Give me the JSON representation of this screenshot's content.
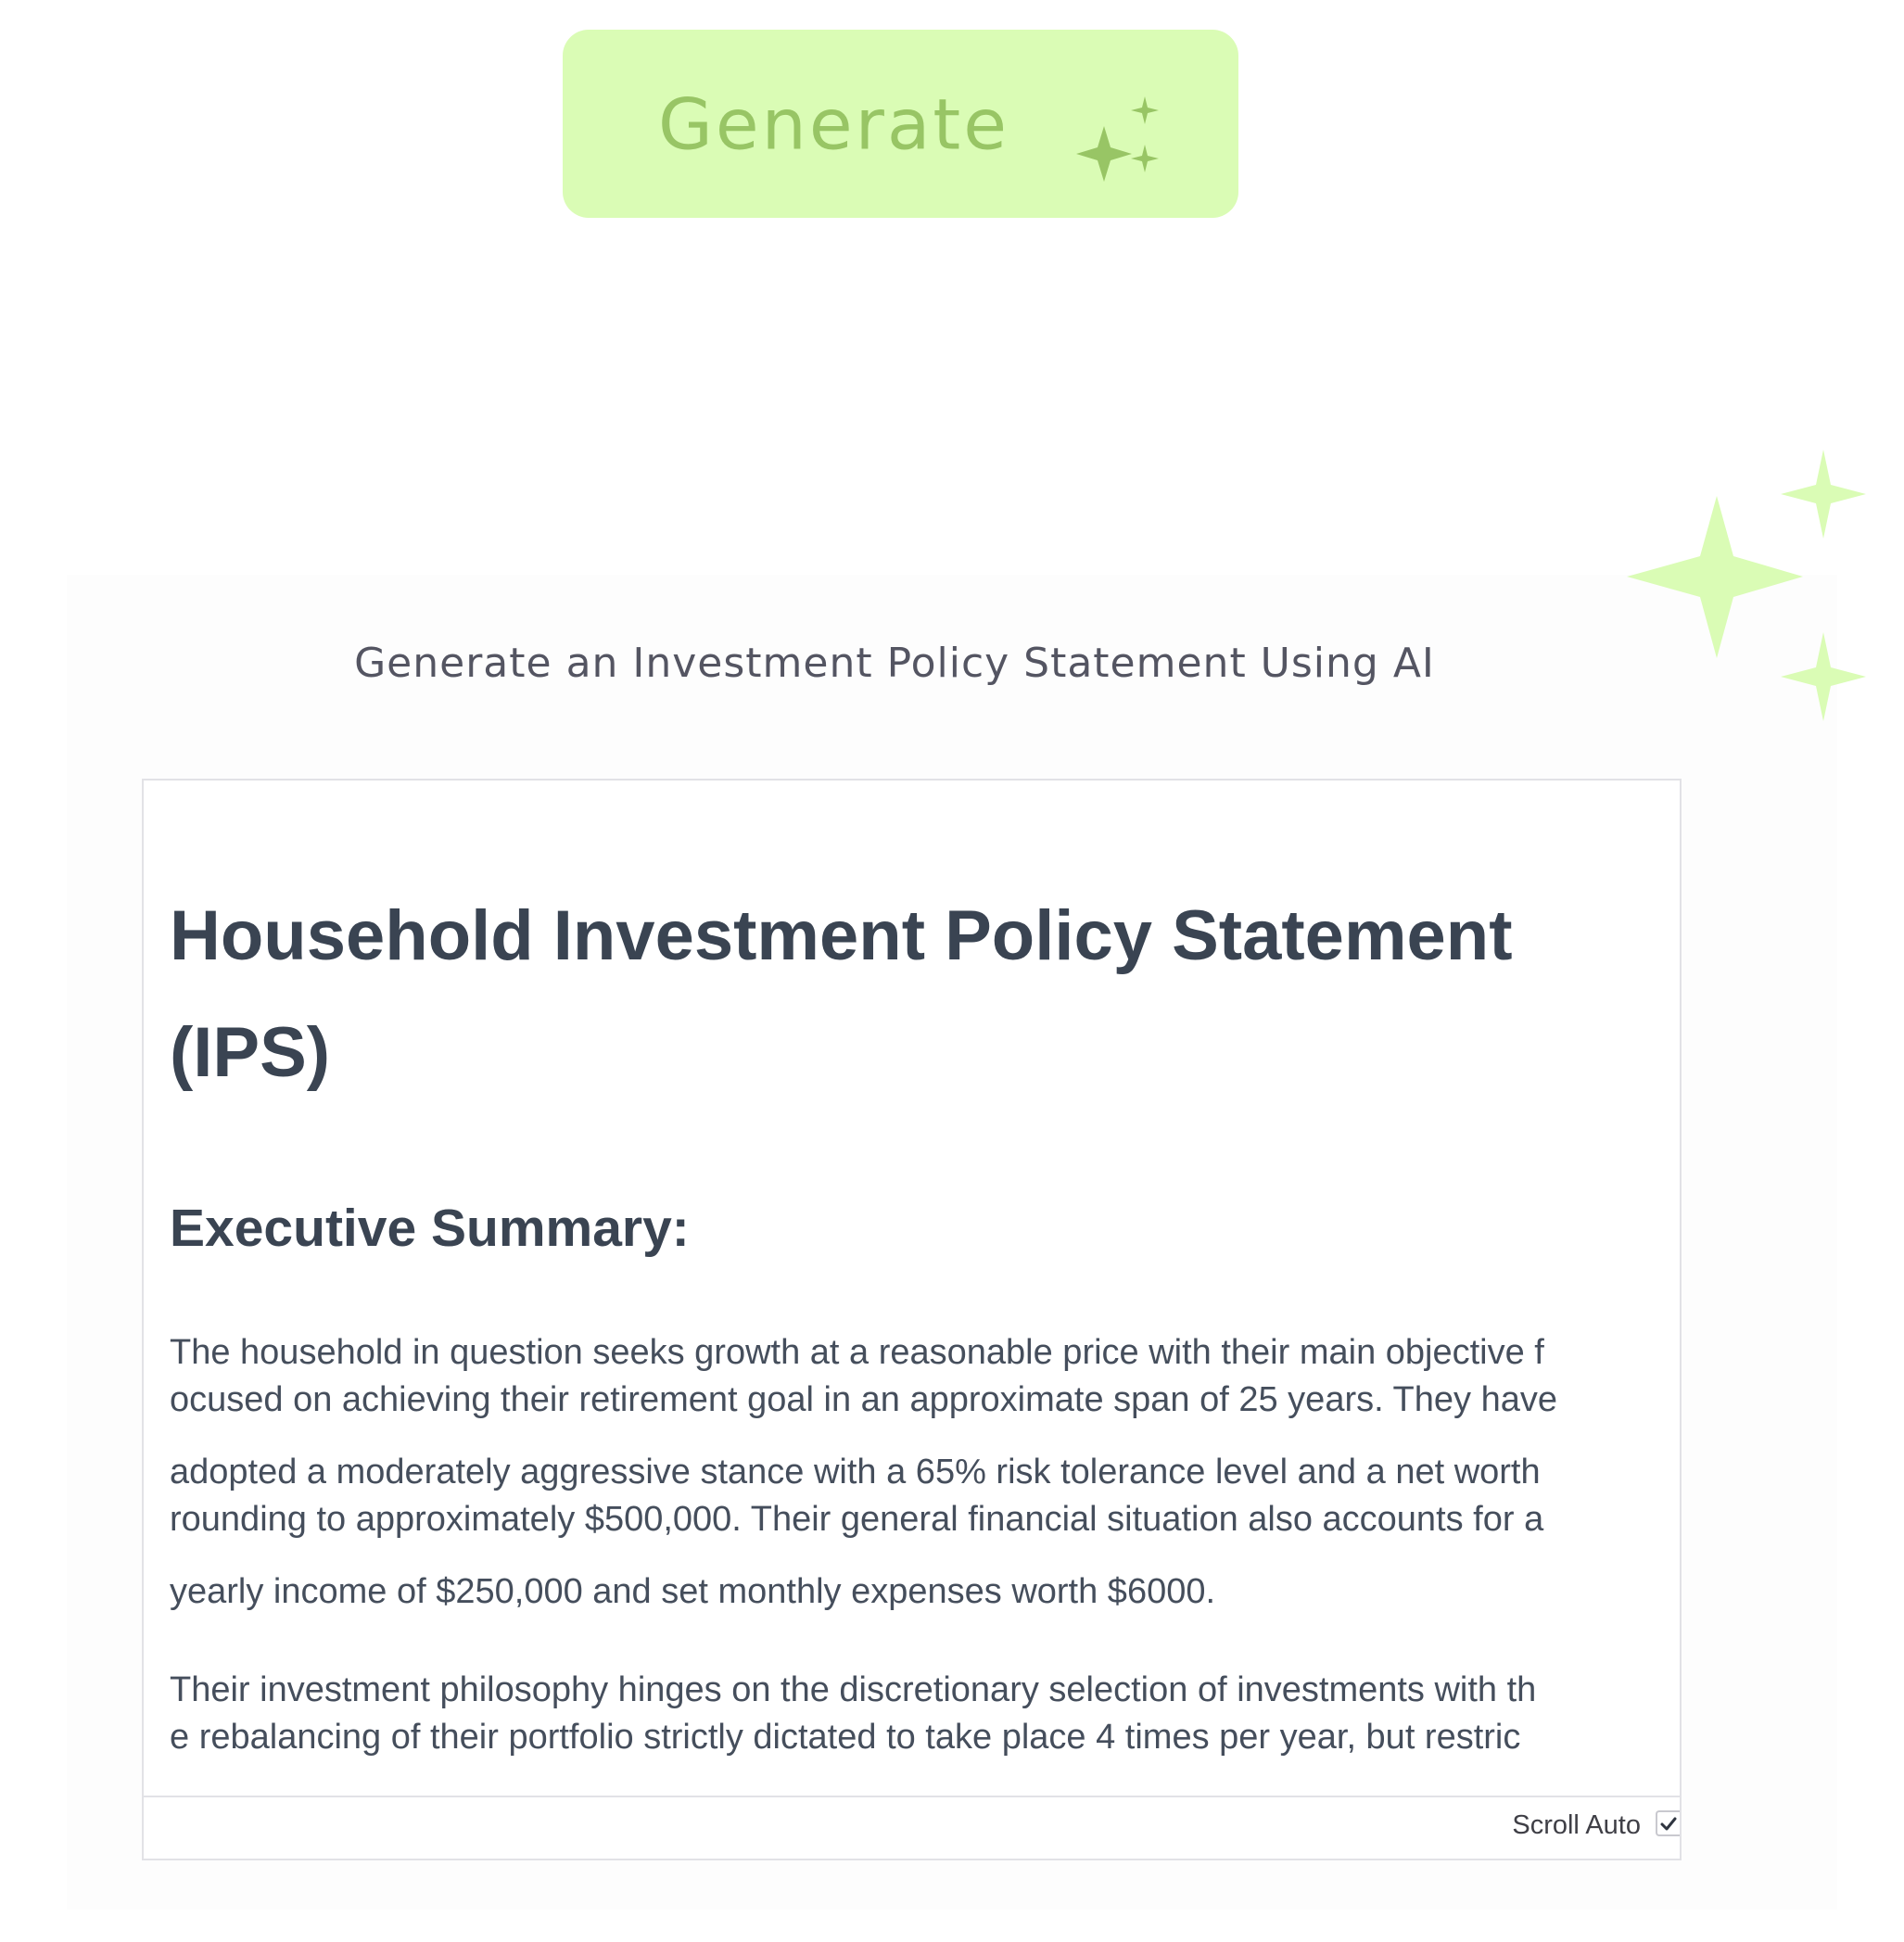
{
  "generate_button": {
    "label": "Generate",
    "icon": "sparkles-icon",
    "background": "#dafcb5",
    "text_color": "#98c565"
  },
  "decorative_icon": "sparkles-icon",
  "subtitle": "Generate an Investment Policy Statement Using AI",
  "output": {
    "title_line1": "Household Investment Policy Statement",
    "title_line2": "(IPS)",
    "heading": "Executive Summary:",
    "paragraph_lines": [
      "The household in question seeks growth at a reasonable price with their main objective f",
      "ocused on achieving their retirement goal in an approximate span of 25 years. They have",
      "adopted a moderately aggressive stance with a 65% risk tolerance level and a net worth",
      "rounding to approximately $500,000. Their general financial situation also accounts for a",
      "yearly income of $250,000 and set monthly expenses worth $6000.",
      "Their investment philosophy hinges on the discretionary selection of investments with th",
      "e rebalancing of their portfolio strictly dictated to take place 4 times per year, but restric"
    ]
  },
  "footer": {
    "scroll_auto_label": "Scroll Auto",
    "scroll_auto_checked": true
  }
}
